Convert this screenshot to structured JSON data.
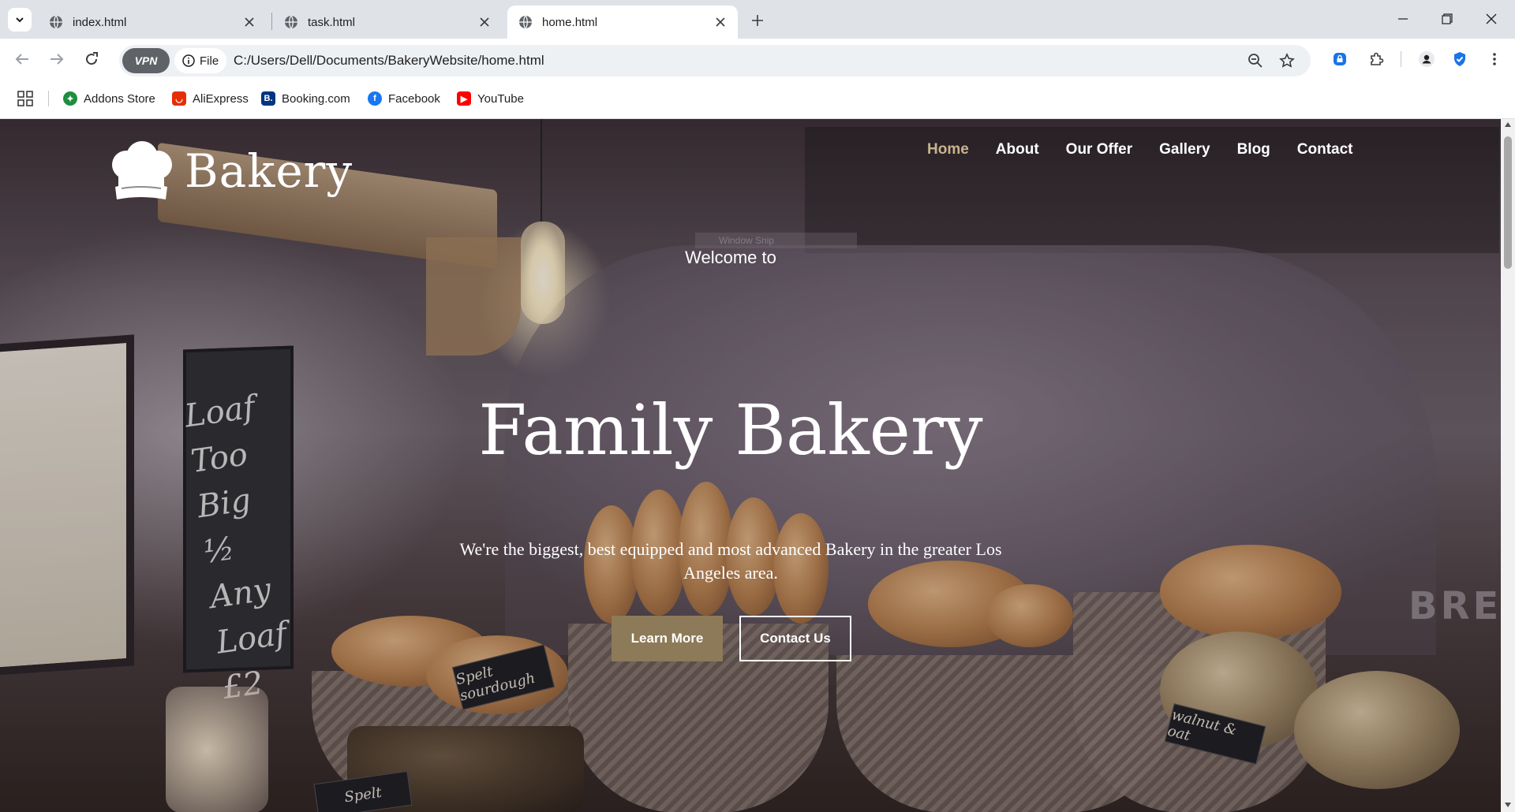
{
  "browser": {
    "tabs": [
      {
        "title": "index.html",
        "active": false
      },
      {
        "title": "task.html",
        "active": false
      },
      {
        "title": "home.html",
        "active": true
      }
    ],
    "vpn_label": "VPN",
    "chip_label": "File",
    "url": "C:/Users/Dell/Documents/BakeryWebsite/home.html",
    "bookmarks": [
      {
        "label": "Addons Store",
        "icon": "addons-store-icon",
        "color": "#1e8e3e"
      },
      {
        "label": "AliExpress",
        "icon": "aliexpress-icon",
        "color": "#e62e04"
      },
      {
        "label": "Booking.com",
        "icon": "booking-icon",
        "color": "#003580"
      },
      {
        "label": "Facebook",
        "icon": "facebook-icon",
        "color": "#1877f2"
      },
      {
        "label": "YouTube",
        "icon": "youtube-icon",
        "color": "#ff0000"
      }
    ]
  },
  "site": {
    "logo_text": "Bakery",
    "nav": [
      {
        "label": "Home",
        "active": true
      },
      {
        "label": "About",
        "active": false
      },
      {
        "label": "Our Offer",
        "active": false
      },
      {
        "label": "Gallery",
        "active": false
      },
      {
        "label": "Blog",
        "active": false
      },
      {
        "label": "Contact",
        "active": false
      }
    ],
    "hero": {
      "snip_label": "Window Snip",
      "welcome": "Welcome to",
      "headline": "Family Bakery",
      "subline": "We're the biggest, best equipped and most advanced Bakery in the greater Los Angeles area.",
      "learn_more": "Learn More",
      "contact_us": "Contact Us"
    },
    "photo_text": {
      "chalkboard": "Loaf Too Big ½ Any Loaf £2",
      "tag_spelt": "Spelt sourdough",
      "tag_spelt2": "Spelt",
      "tag_walnut": "walnut & oat",
      "wall_sign": "BRE"
    },
    "colors": {
      "accent": "#c9b48b",
      "button": "#8d7a58"
    }
  }
}
